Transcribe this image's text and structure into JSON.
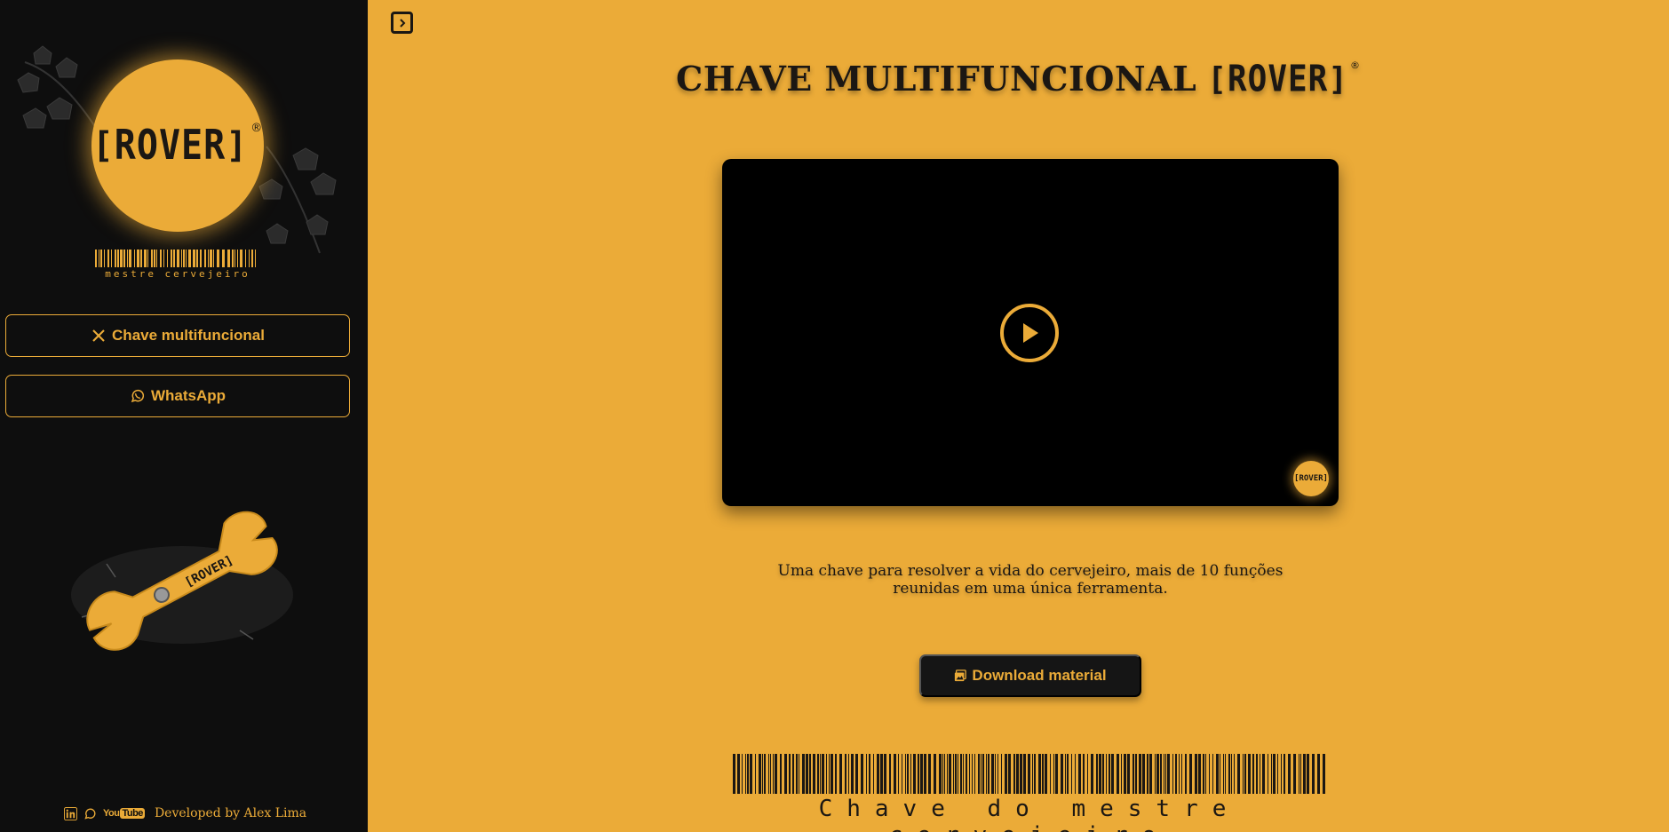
{
  "colors": {
    "accent": "#ebab38",
    "sidebar_bg": "#0e0e0e",
    "dark_text": "#1b1713"
  },
  "sidebar": {
    "logo": {
      "brand": "ROVER",
      "registered": "®"
    },
    "tagline": "mestre cervejeiro",
    "nav": [
      {
        "label": "Chave multifuncional",
        "icon": "tools-icon"
      },
      {
        "label": "WhatsApp",
        "icon": "whatsapp-icon"
      }
    ],
    "footer": {
      "social": [
        {
          "name": "LinkedIn",
          "icon": "linkedin-icon"
        },
        {
          "name": "WhatsApp",
          "icon": "whatsapp-icon"
        },
        {
          "name": "YouTube",
          "icon": "youtube-icon",
          "text": "You",
          "text2": "Tube"
        }
      ],
      "credit": "Developed by Alex Lima"
    }
  },
  "main": {
    "title_text": "CHAVE MULTIFUNCIONAL",
    "title_brand": "ROVER",
    "title_reg": "®",
    "video": {
      "badge_brand": "ROVER"
    },
    "description": "Uma chave para resolver a vida do cervejeiro, mais de 10 funções reunidas em uma única ferramenta.",
    "download_label": "Download material",
    "footer_tagline": "Chave do mestre cervejeiro"
  }
}
